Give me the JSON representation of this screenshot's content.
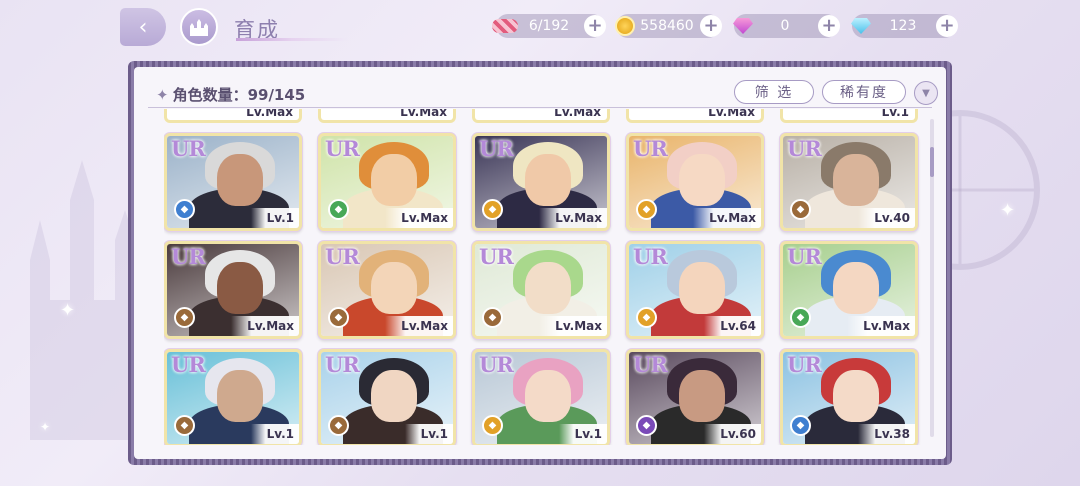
{
  "header": {
    "title": "育成",
    "back_icon": "back-arrow-icon",
    "home_icon": "castle-home-icon"
  },
  "resources": [
    {
      "name": "candy",
      "value": "6/192"
    },
    {
      "name": "coin",
      "value": "558460"
    },
    {
      "name": "pink-diamond",
      "value": "0"
    },
    {
      "name": "blue-diamond",
      "value": "123"
    }
  ],
  "panel": {
    "count_label": "角色数量：99/145",
    "filter_label": "筛 选",
    "sort_label": "稀有度"
  },
  "top_row_levels": [
    "Lv.Max",
    "Lv.Max",
    "Lv.Max",
    "Lv.Max",
    "Lv.1"
  ],
  "cards": [
    {
      "rarity": "UR",
      "level": "Lv.1",
      "attr_color": "#3f7fd0",
      "hair": "#d9d9d9",
      "skin": "#c8977a",
      "cloth": "#2c2c3a",
      "bg": "#9bb2c9"
    },
    {
      "rarity": "UR",
      "level": "Lv.Max",
      "attr_color": "#48a857",
      "hair": "#e08e3a",
      "skin": "#f2cda6",
      "cloth": "#f2e6c8",
      "bg": "#cfe3a8"
    },
    {
      "rarity": "UR",
      "level": "Lv.Max",
      "attr_color": "#e2a128",
      "hair": "#efe6c2",
      "skin": "#f0c9a8",
      "cloth": "#2d2a44",
      "bg": "#3a3556"
    },
    {
      "rarity": "UR",
      "level": "Lv.Max",
      "attr_color": "#e2a128",
      "hair": "#f2cfc6",
      "skin": "#f6d9c4",
      "cloth": "#3c5aa6",
      "bg": "#e9b46a"
    },
    {
      "rarity": "UR",
      "level": "Lv.40",
      "attr_color": "#9a6a3a",
      "hair": "#8a7a6a",
      "skin": "#d9b49a",
      "cloth": "#efe7dc",
      "bg": "#b8b0a6"
    },
    {
      "rarity": "UR",
      "level": "Lv.Max",
      "attr_color": "#9a6a3a",
      "hair": "#e6e6e6",
      "skin": "#8a5a44",
      "cloth": "#3b2f30",
      "bg": "#4a3a3c"
    },
    {
      "rarity": "UR",
      "level": "Lv.Max",
      "attr_color": "#9a6a3a",
      "hair": "#e2b279",
      "skin": "#f3d5b8",
      "cloth": "#c9482c",
      "bg": "#d9c7b4"
    },
    {
      "rarity": "UR",
      "level": "Lv.Max",
      "attr_color": "#9a6a3a",
      "hair": "#a9d88c",
      "skin": "#f2ddc8",
      "cloth": "#f2efe6",
      "bg": "#dfe9d6"
    },
    {
      "rarity": "UR",
      "level": "Lv.64",
      "attr_color": "#e2a128",
      "hair": "#b9c9dc",
      "skin": "#f4d5bd",
      "cloth": "#c23a3a",
      "bg": "#9fd0e8"
    },
    {
      "rarity": "UR",
      "level": "Lv.Max",
      "attr_color": "#48a857",
      "hair": "#4a8ad0",
      "skin": "#f4d7c2",
      "cloth": "#e6ecf3",
      "bg": "#a7cf8e"
    },
    {
      "rarity": "UR",
      "level": "Lv.1",
      "attr_color": "#9a6a3a",
      "hair": "#e6e6ee",
      "skin": "#cfa98e",
      "cloth": "#2a3a5e",
      "bg": "#68c0d8"
    },
    {
      "rarity": "UR",
      "level": "Lv.1",
      "attr_color": "#9a6a3a",
      "hair": "#2a2a34",
      "skin": "#f0d6c2",
      "cloth": "#3a2c2a",
      "bg": "#a9d2ea"
    },
    {
      "rarity": "UR",
      "level": "Lv.1",
      "attr_color": "#e2a128",
      "hair": "#e9a2c2",
      "skin": "#f4dac8",
      "cloth": "#5a9a5a",
      "bg": "#b9c8d6"
    },
    {
      "rarity": "UR",
      "level": "Lv.60",
      "attr_color": "#7a4ab8",
      "hair": "#3a2a3a",
      "skin": "#c89a82",
      "cloth": "#2a2a2a",
      "bg": "#5a4a5e"
    },
    {
      "rarity": "UR",
      "level": "Lv.38",
      "attr_color": "#3f7fd0",
      "hair": "#c83a3a",
      "skin": "#f4dac8",
      "cloth": "#2a2a3a",
      "bg": "#8cc2e2"
    }
  ]
}
